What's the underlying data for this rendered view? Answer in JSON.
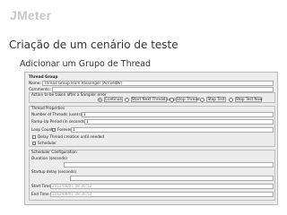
{
  "header": {
    "logo": "JMeter",
    "title": "Criação de um cenário de teste",
    "subtitle": "Adicionar um Grupo de Thread"
  },
  "thread_group": {
    "panel_title": "Thread Group",
    "name_label": "Name:",
    "name_value": "Thread Group From Passenger (ArrivedAr)",
    "comments_label": "Comments:",
    "action_label": "Action to be taken after a Sampler error",
    "error_actions": [
      {
        "label": "Continue",
        "selected": true
      },
      {
        "label": "Start Next Thread Loop",
        "selected": false
      },
      {
        "label": "Stop Thread",
        "selected": false
      },
      {
        "label": "Stop Test",
        "selected": false
      },
      {
        "label": "Stop Test Now",
        "selected": false
      }
    ]
  },
  "thread_properties": {
    "title": "Thread Properties",
    "num_threads_label": "Number of Threads (users):",
    "num_threads_value": "1",
    "ramp_up_label": "Ramp-Up Period (in seconds):",
    "ramp_up_value": "1",
    "loop_label": "Loop Count:",
    "forever_label": "Forever",
    "loop_value": "1",
    "delay_label": "Delay Thread creation until needed",
    "scheduler_label": "Scheduler"
  },
  "scheduler_config": {
    "title": "Scheduler Configuration",
    "duration_label": "Duration (seconds)",
    "startup_delay_label": "Startup delay (seconds)",
    "start_time_label": "Start Time",
    "start_time_value": "2012/08/01 08:30:52",
    "end_time_label": "End Time",
    "end_time_value": "2012/08/01 08:30:52"
  }
}
